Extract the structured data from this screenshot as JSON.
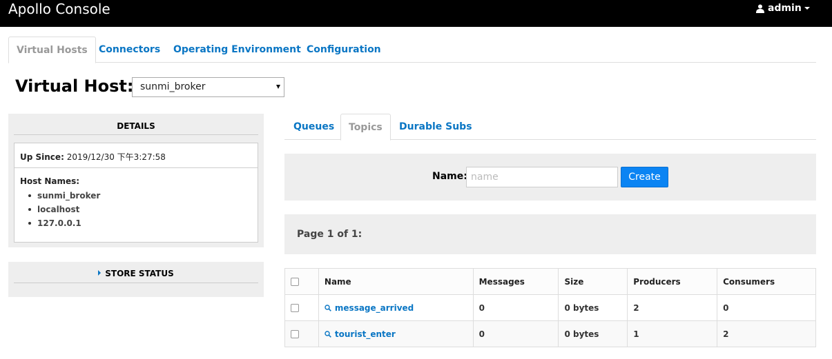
{
  "app": {
    "title": "Apollo Console",
    "user": "admin"
  },
  "nav_tabs": [
    {
      "label": "Virtual Hosts"
    },
    {
      "label": "Connectors"
    },
    {
      "label": "Operating Environment"
    },
    {
      "label": "Configuration"
    }
  ],
  "virtual_host": {
    "label": "Virtual Host:",
    "selected": "sunmi_broker"
  },
  "details": {
    "heading": "DETAILS",
    "up_since_label": "Up Since:",
    "up_since_value": "2019/12/30 下午3:27:58",
    "host_names_label": "Host Names:",
    "host_names": [
      "sunmi_broker",
      "localhost",
      "127.0.0.1"
    ]
  },
  "store_status": {
    "heading": "STORE STATUS"
  },
  "sub_tabs": [
    {
      "label": "Queues"
    },
    {
      "label": "Topics"
    },
    {
      "label": "Durable Subs"
    }
  ],
  "create_form": {
    "name_label": "Name:",
    "placeholder": "name",
    "value": "",
    "button": "Create"
  },
  "paging": {
    "text": "Page 1 of 1:"
  },
  "table": {
    "columns": [
      "Name",
      "Messages",
      "Size",
      "Producers",
      "Consumers"
    ],
    "rows": [
      {
        "name": "message_arrived",
        "messages": "0",
        "size": "0 bytes",
        "producers": "2",
        "consumers": "0"
      },
      {
        "name": "tourist_enter",
        "messages": "0",
        "size": "0 bytes",
        "producers": "1",
        "consumers": "2"
      }
    ]
  },
  "colors": {
    "navbar": "#000000",
    "link": "#0a76c4",
    "button": "#0b84f3",
    "panel": "#eeeeee"
  }
}
